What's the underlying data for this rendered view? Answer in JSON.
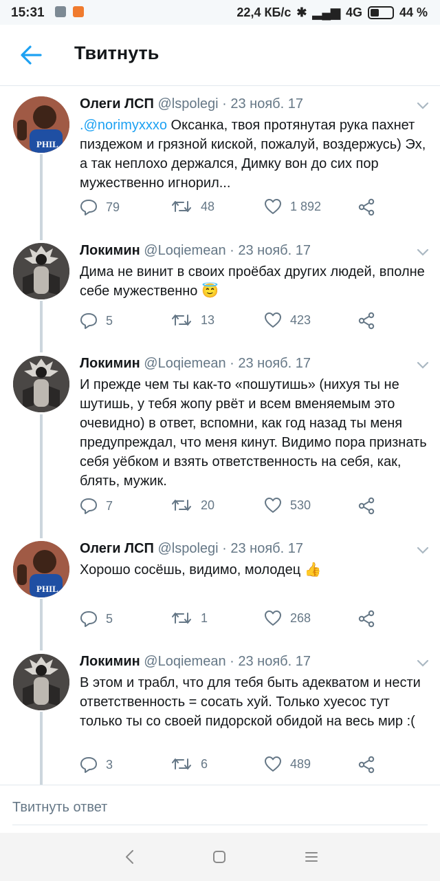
{
  "status_bar": {
    "time": "15:31",
    "speed": "22,4 КБ/с",
    "network": "4G",
    "battery": "44 %"
  },
  "header": {
    "title": "Твитнуть"
  },
  "tweets": [
    {
      "name": "Олеги ЛСП",
      "handle": "@lspolegi",
      "date": "23 нояб. 17",
      "mention": ".@norimyxxxo",
      "text": " Оксанка, твоя протянутая рука пахнет пиздежом и грязной киской, пожалуй, воздержусь) Эх, а так неплохо держался, Димку вон до сих пор мужественно игнорил...",
      "replies": "79",
      "retweets": "48",
      "likes": "1 892"
    },
    {
      "name": "Локимин",
      "handle": "@Loqiemean",
      "date": "23 нояб. 17",
      "text": "Дима не винит в своих проёбах других людей, вполне себе мужественно 😇",
      "replies": "5",
      "retweets": "13",
      "likes": "423"
    },
    {
      "name": "Локимин",
      "handle": "@Loqiemean",
      "date": "23 нояб. 17",
      "text": "И прежде чем ты как-то «пошутишь» (нихуя ты не шутишь, у тебя жопу рвёт и всем вменяемым это очевидно) в ответ, вспомни, как год назад ты меня предупреждал, что меня кинут. Видимо пора признать себя уёбком и взять ответственность на себя, как, блять, мужик.",
      "replies": "7",
      "retweets": "20",
      "likes": "530"
    },
    {
      "name": "Олеги ЛСП",
      "handle": "@lspolegi",
      "date": "23 нояб. 17",
      "text": "Хорошо сосёшь, видимо, молодец 👍",
      "replies": "5",
      "retweets": "1",
      "likes": "268"
    },
    {
      "name": "Локимин",
      "handle": "@Loqiemean",
      "date": "23 нояб. 17",
      "text": "В этом и трабл, что для тебя быть адекватом и нести ответственность = сосать хуй. Только хуесос тут только ты со своей пидорской обидой на весь мир :(",
      "replies": "3",
      "retweets": "6",
      "likes": "489"
    }
  ],
  "compose": {
    "placeholder": "Твитнуть ответ"
  },
  "colors": {
    "accent": "#1da1f2",
    "secondary_text": "#657786"
  },
  "icons": [
    "back-arrow-icon",
    "chevron-down-icon",
    "reply-icon",
    "retweet-icon",
    "like-icon",
    "share-icon",
    "nav-back-icon",
    "nav-home-icon",
    "nav-menu-icon"
  ]
}
